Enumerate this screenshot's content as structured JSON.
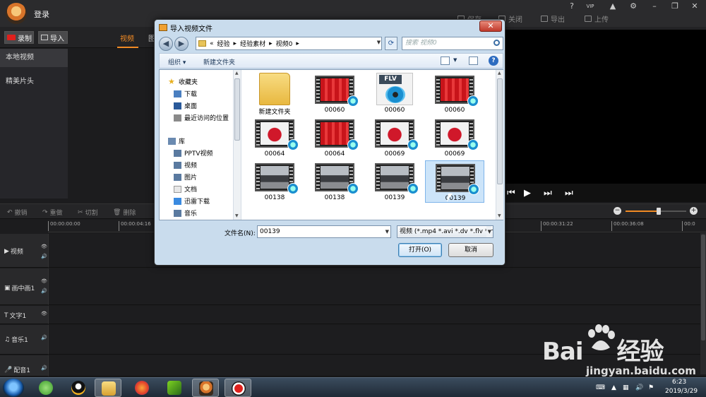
{
  "app": {
    "login_label": "登录",
    "top_actions": [
      "保存",
      "关闭",
      "导出",
      "上传"
    ],
    "window_controls": [
      "?",
      "VIP",
      "▲",
      "⚙",
      "–",
      "❐",
      "✕"
    ]
  },
  "toolbar": {
    "record_label": "录制",
    "import_label": "导入"
  },
  "media_tabs": {
    "video": "视频",
    "picture": "图"
  },
  "left_nav": {
    "items": [
      "本地视频",
      "精美片头"
    ]
  },
  "edit_tools": [
    "撤销",
    "重做",
    "切割",
    "删除"
  ],
  "zoom": {
    "level": 0.55
  },
  "player": {
    "buttons": [
      "⏮",
      "▶",
      "⏭",
      "⏭"
    ]
  },
  "ruler_ticks": [
    "00:00:00:00",
    "00:00:04:16",
    "00:00:31:22",
    "00:00:36:08",
    "00:0"
  ],
  "tracks": [
    {
      "name": "视频",
      "icons": [
        "👁",
        "🔊"
      ]
    },
    {
      "name": "画中画1",
      "icons": [
        "👁",
        "🔊"
      ]
    },
    {
      "name": "文字1",
      "icons": [
        "👁"
      ]
    },
    {
      "name": "音乐1",
      "icons": [
        "🔊"
      ]
    },
    {
      "name": "配音1",
      "icons": [
        "🔊"
      ]
    }
  ],
  "dialog": {
    "title": "导入视频文件",
    "close_label": "✕",
    "path": [
      "«",
      "经验",
      "经验素材",
      "视频0"
    ],
    "search_placeholder": "搜索 视频0",
    "organize_label": "组织 ▾",
    "new_folder_label": "新建文件夹",
    "help_label": "?",
    "tree": {
      "favorites": "收藏夹",
      "favorites_items": [
        "下载",
        "桌面",
        "最近访问的位置"
      ],
      "libraries": "库",
      "library_items": [
        "PPTV视频",
        "视频",
        "图片",
        "文档",
        "迅雷下载",
        "音乐"
      ]
    },
    "files": [
      {
        "name": "新建文件夹",
        "type": "folder"
      },
      {
        "name": "00060",
        "type": "video",
        "scene": "red"
      },
      {
        "name": "00060",
        "type": "flv",
        "tag": "FLV"
      },
      {
        "name": "00060",
        "type": "video",
        "scene": "red"
      },
      {
        "name": "00064",
        "type": "video",
        "scene": "redwhite"
      },
      {
        "name": "00064",
        "type": "video",
        "scene": "red"
      },
      {
        "name": "00069",
        "type": "video",
        "scene": "redwhite"
      },
      {
        "name": "00069",
        "type": "video",
        "scene": "redwhite"
      },
      {
        "name": "00138",
        "type": "video",
        "scene": "car"
      },
      {
        "name": "00138",
        "type": "video",
        "scene": "car"
      },
      {
        "name": "00139",
        "type": "video",
        "scene": "car"
      },
      {
        "name": "00139",
        "type": "video",
        "scene": "car",
        "selected": true
      }
    ],
    "filename_label": "文件名(N):",
    "filename_value": "00139",
    "filetype_value": "视频 (*.mp4 *.avi *.dv *.flv *.m",
    "open_label": "打开(O)",
    "cancel_label": "取消"
  },
  "taskbar": {
    "apps": [
      "refresh-app",
      "qq",
      "explorer",
      "firefox",
      "media",
      "editor",
      "recorder"
    ],
    "time": "6:23",
    "date": "2019/3/29"
  },
  "watermark": {
    "brand_a": "Bai",
    "brand_b": "经验",
    "url": "jingyan.baidu.com"
  },
  "colors": {
    "accent": "#f08a24",
    "selection": "#cce4f9",
    "dialog_frame": "#c9dced"
  }
}
